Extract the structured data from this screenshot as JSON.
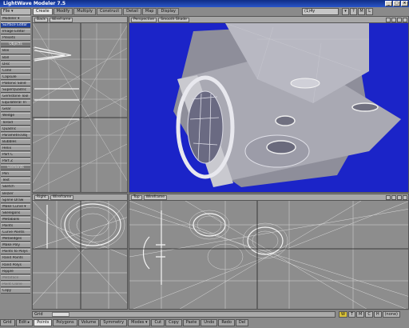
{
  "window": {
    "title": "LightWave Modeler 7.5",
    "buttons": [
      "_",
      "□",
      "×"
    ]
  },
  "menubar": {
    "file_label": "File ▾",
    "tabs": [
      {
        "label": "Create",
        "active": true
      },
      {
        "label": "Modify",
        "active": false
      },
      {
        "label": "Multiply",
        "active": false
      },
      {
        "label": "Construct",
        "active": false
      },
      {
        "label": "Detail",
        "active": false
      },
      {
        "label": "Map",
        "active": false
      },
      {
        "label": "Display",
        "active": false
      }
    ],
    "user_value": "(1)4y",
    "mini_icons": [
      "▾",
      "?",
      "M",
      "L"
    ]
  },
  "sidebar": {
    "items": [
      {
        "label": "Modeler ▾",
        "kind": "btn"
      },
      {
        "label": "Surface Editor",
        "kind": "hl"
      },
      {
        "label": "Image Editor",
        "kind": "btn"
      },
      {
        "label": "Presets",
        "kind": "btn"
      },
      {
        "label": "Objects",
        "kind": "hdr"
      },
      {
        "label": "Box",
        "kind": "btn"
      },
      {
        "label": "Ball",
        "kind": "btn"
      },
      {
        "label": "Disc",
        "kind": "btn"
      },
      {
        "label": "Cone",
        "kind": "btn"
      },
      {
        "label": "Capsule",
        "kind": "btn"
      },
      {
        "label": "Platonic Solid",
        "kind": "btn"
      },
      {
        "label": "SuperQuadric",
        "kind": "btn"
      },
      {
        "label": "Gemstone Tool",
        "kind": "btn"
      },
      {
        "label": "Equilateral Tri",
        "kind": "btn"
      },
      {
        "label": "Gear",
        "kind": "btn"
      },
      {
        "label": "Wedge",
        "kind": "btn"
      },
      {
        "label": "Toroid",
        "kind": "btn"
      },
      {
        "label": "Quadric",
        "kind": "btn"
      },
      {
        "label": "ParametricObj",
        "kind": "btn"
      },
      {
        "label": "Bubbles",
        "kind": "btn"
      },
      {
        "label": "Helix",
        "kind": "btn"
      },
      {
        "label": "Part C",
        "kind": "btn"
      },
      {
        "label": "Part Z",
        "kind": "btn"
      },
      {
        "label": "Elements",
        "kind": "hdr"
      },
      {
        "label": "Pen",
        "kind": "btn"
      },
      {
        "label": "Text",
        "kind": "btn"
      },
      {
        "label": "Sketch",
        "kind": "btn"
      },
      {
        "label": "Bezier",
        "kind": "btn"
      },
      {
        "label": "Spline Draw",
        "kind": "btn"
      },
      {
        "label": "Make Curve ▾",
        "kind": "btn"
      },
      {
        "label": "Skelegons",
        "kind": "btn"
      },
      {
        "label": "Metaballs",
        "kind": "btn"
      },
      {
        "label": "Points",
        "kind": "btn"
      },
      {
        "label": "Curve Points",
        "kind": "btn"
      },
      {
        "label": "Metaedges",
        "kind": "btn"
      },
      {
        "label": "Make Poly",
        "kind": "btn"
      },
      {
        "label": "Points to Polys",
        "kind": "btn"
      },
      {
        "label": "Rand Points",
        "kind": "btn"
      },
      {
        "label": "Rand Polys",
        "kind": "btn"
      },
      {
        "label": "Ripple",
        "kind": "btn"
      },
      {
        "label": "Metaface",
        "kind": "dim"
      },
      {
        "label": "Point Clone",
        "kind": "dim"
      },
      {
        "label": "Copy",
        "kind": "btn"
      }
    ]
  },
  "viewports": {
    "top_left": {
      "view": "Back",
      "mode": "Wireframe"
    },
    "top_right": {
      "view": "Perspective",
      "mode": "Smooth Shade"
    },
    "bottom_left": {
      "view": "Right",
      "mode": "Wireframe"
    },
    "bottom_right": {
      "view": "Top",
      "mode": "Wireframe"
    },
    "colors": {
      "wire_bg": "#8d8d8d",
      "persp_bg": "#1b24c8",
      "mesh": "#dcdcdc"
    }
  },
  "statusbar": {
    "grid_label": "Grid",
    "grid_value": "",
    "right_items": [
      "W",
      "T",
      "M",
      "C",
      "H",
      "(none)"
    ],
    "modes": [
      {
        "label": "Grid",
        "style": "normal"
      },
      {
        "label": "Edit ▸",
        "style": "normal"
      },
      {
        "label": "Points",
        "style": "active"
      },
      {
        "label": "Polygons",
        "style": "normal"
      },
      {
        "label": "Volume",
        "style": "normal"
      },
      {
        "label": "Symmetry",
        "style": "normal"
      },
      {
        "label": "Modes ▾",
        "style": "normal"
      },
      {
        "label": "Cut",
        "style": "normal"
      },
      {
        "label": "Copy",
        "style": "normal"
      },
      {
        "label": "Paste",
        "style": "normal"
      },
      {
        "label": "Undo",
        "style": "normal"
      },
      {
        "label": "Redo",
        "style": "normal"
      },
      {
        "label": "Del",
        "style": "normal"
      }
    ]
  }
}
